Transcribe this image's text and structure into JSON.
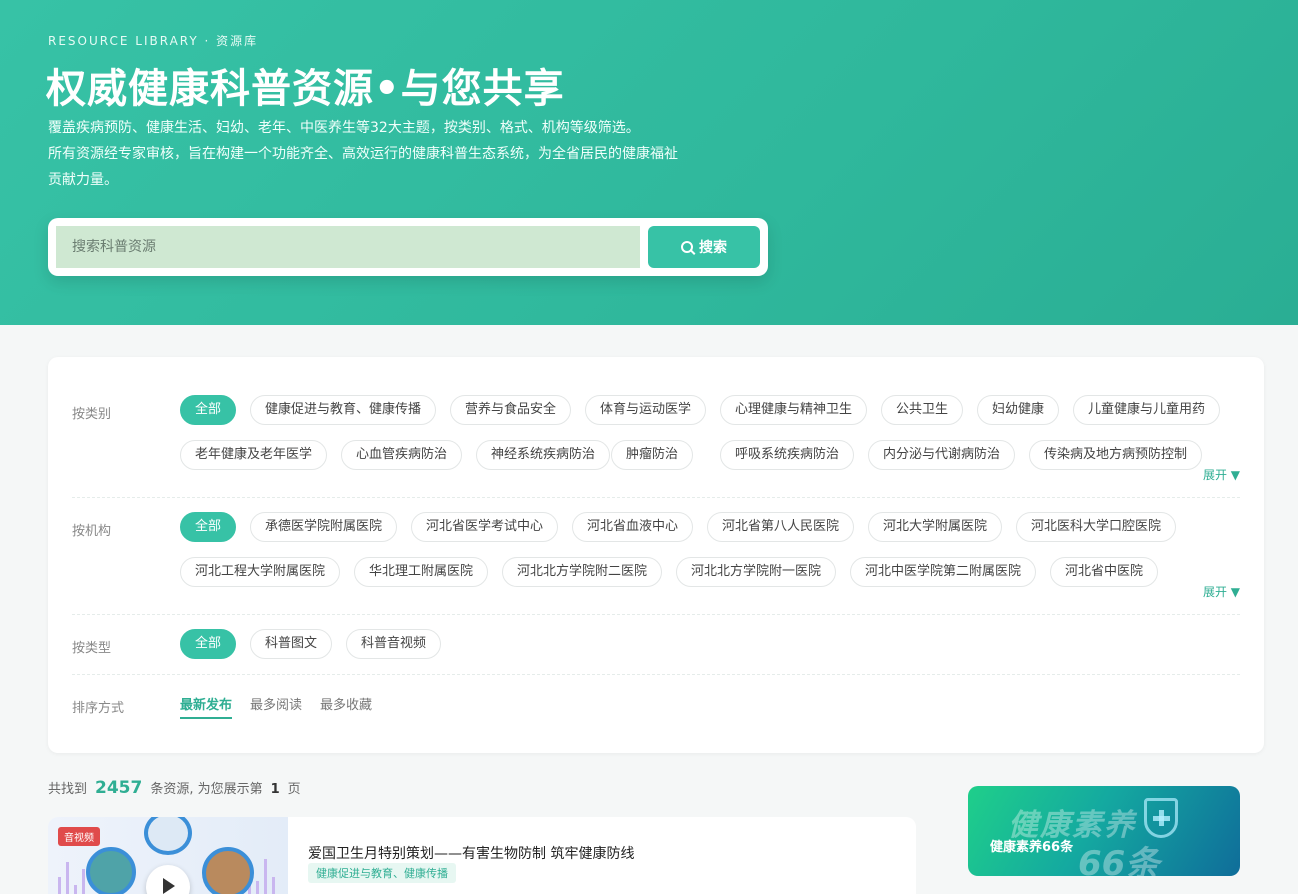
{
  "hero": {
    "eyebrow": "RESOURCE LIBRARY · 资源库",
    "title": "权威健康科普资源•与您共享",
    "desc_line1": "覆盖疾病预防、健康生活、妇幼、老年、中医养生等32大主题，按类别、格式、机构等级筛选。",
    "desc_line2": "所有资源经专家审核，旨在构建一个功能齐全、高效运行的健康科普生态系统，为全省居民的健康福祉贡献力量。"
  },
  "search": {
    "placeholder": "搜索科普资源",
    "button_label": "搜索"
  },
  "filters": {
    "category": {
      "label": "按类别",
      "items": [
        "全部",
        "健康促进与教育、健康传播",
        "营养与食品安全",
        "体育与运动医学",
        "心理健康与精神卫生",
        "公共卫生",
        "妇幼健康",
        "儿童健康与儿童用药",
        "老年健康及老年医学",
        "心血管疾病防治",
        "神经系统疾病防治",
        "肿瘤防治",
        "呼吸系统疾病防治",
        "内分泌与代谢病防治",
        "传染病及地方病预防控制"
      ],
      "expand": "展开 ▼"
    },
    "institution": {
      "label": "按机构",
      "items": [
        "全部",
        "承德医学院附属医院",
        "河北省医学考试中心",
        "河北省血液中心",
        "河北省第八人民医院",
        "河北大学附属医院",
        "河北医科大学口腔医院",
        "河北工程大学附属医院",
        "华北理工附属医院",
        "河北北方学院附二医院",
        "河北北方学院附一医院",
        "河北中医学院第二附属医院",
        "河北省中医院"
      ],
      "expand": "展开 ▼"
    },
    "type": {
      "label": "按类型",
      "items": [
        "全部",
        "科普图文",
        "科普音视频"
      ]
    },
    "sort": {
      "label": "排序方式",
      "items": [
        "最新发布",
        "最多阅读",
        "最多收藏"
      ]
    }
  },
  "results": {
    "prefix": "共找到",
    "count": "2457",
    "middle": "条资源, 为您展示第",
    "page": "1",
    "suffix": "页"
  },
  "article": {
    "badge": "音视频",
    "title": "爱国卫生月特别策划——有害生物防制 筑牢健康防线",
    "tag": "健康促进与教育、健康传播"
  },
  "promo": {
    "big_text": "健康素养",
    "big_num": "66条",
    "label": "健康素养66条"
  },
  "colors": {
    "accent": "#37c2a6",
    "accent_dark": "#2fae93"
  }
}
